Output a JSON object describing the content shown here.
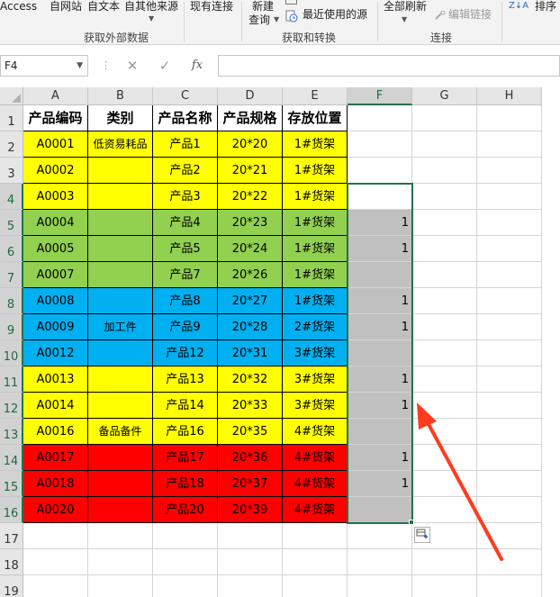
{
  "ribbon": {
    "ext_data": {
      "access": "Access",
      "web": "自网站",
      "text": "自文本",
      "other": "自其他来源",
      "existing": "现有连接",
      "group_label": "获取外部数据"
    },
    "transform": {
      "new_query_line1": "新建",
      "new_query_line2": "查询",
      "recent_sources": "最近使用的源",
      "group_label": "获取和转换"
    },
    "connections": {
      "refresh_all": "全部刷新",
      "edit_links": "编辑链接",
      "group_label": "连接"
    },
    "sort": {
      "sort_az": "Z↓A",
      "sort": "排序"
    }
  },
  "formula_bar": {
    "name_box": "F4",
    "cancel": "✕",
    "enter": "✓",
    "fx": "fx",
    "value": ""
  },
  "grid": {
    "columns": [
      "A",
      "B",
      "C",
      "D",
      "E",
      "F",
      "G",
      "H"
    ],
    "rows": [
      "1",
      "2",
      "3",
      "4",
      "5",
      "6",
      "7",
      "8",
      "9",
      "10",
      "11",
      "12",
      "13",
      "14",
      "15",
      "16",
      "17",
      "18",
      "19"
    ],
    "header": [
      "产品编码",
      "类别",
      "产品名称",
      "产品规格",
      "存放位置"
    ],
    "data": [
      {
        "a": "A0001",
        "b": "低资易耗品",
        "c": "产品1",
        "d": "20*20",
        "e": "1#货架",
        "f": "",
        "color": "#ffff00"
      },
      {
        "a": "A0002",
        "b": "",
        "c": "产品2",
        "d": "20*21",
        "e": "1#货架",
        "f": "",
        "color": "#ffff00"
      },
      {
        "a": "A0003",
        "b": "",
        "c": "产品3",
        "d": "20*22",
        "e": "1#货架",
        "f": "",
        "color": "#ffff00"
      },
      {
        "a": "A0004",
        "b": "",
        "c": "产品4",
        "d": "20*23",
        "e": "1#货架",
        "f": "1",
        "color": "#92d050"
      },
      {
        "a": "A0005",
        "b": "",
        "c": "产品5",
        "d": "20*24",
        "e": "1#货架",
        "f": "1",
        "color": "#92d050"
      },
      {
        "a": "A0007",
        "b": "",
        "c": "产品7",
        "d": "20*26",
        "e": "1#货架",
        "f": "",
        "color": "#92d050"
      },
      {
        "a": "A0008",
        "b": "",
        "c": "产品8",
        "d": "20*27",
        "e": "1#货架",
        "f": "1",
        "color": "#00b0f0"
      },
      {
        "a": "A0009",
        "b": "加工件",
        "c": "产品9",
        "d": "20*28",
        "e": "2#货架",
        "f": "1",
        "color": "#00b0f0"
      },
      {
        "a": "A0012",
        "b": "",
        "c": "产品12",
        "d": "20*31",
        "e": "3#货架",
        "f": "",
        "color": "#00b0f0"
      },
      {
        "a": "A0013",
        "b": "",
        "c": "产品13",
        "d": "20*32",
        "e": "3#货架",
        "f": "1",
        "color": "#ffff00"
      },
      {
        "a": "A0014",
        "b": "",
        "c": "产品14",
        "d": "20*33",
        "e": "3#货架",
        "f": "1",
        "color": "#ffff00"
      },
      {
        "a": "A0016",
        "b": "备品备件",
        "c": "产品16",
        "d": "20*35",
        "e": "4#货架",
        "f": "",
        "color": "#ffff00"
      },
      {
        "a": "A0017",
        "b": "",
        "c": "产品17",
        "d": "20*36",
        "e": "4#货架",
        "f": "1",
        "color": "#ff0000"
      },
      {
        "a": "A0018",
        "b": "",
        "c": "产品18",
        "d": "20*37",
        "e": "4#货架",
        "f": "1",
        "color": "#ff0000"
      },
      {
        "a": "A0020",
        "b": "",
        "c": "产品20",
        "d": "20*39",
        "e": "4#货架",
        "f": "",
        "color": "#ff0000"
      }
    ],
    "selection_fill": "#c0c0c0",
    "accent": "#217346",
    "arrow_color": "#ff3b1f"
  }
}
